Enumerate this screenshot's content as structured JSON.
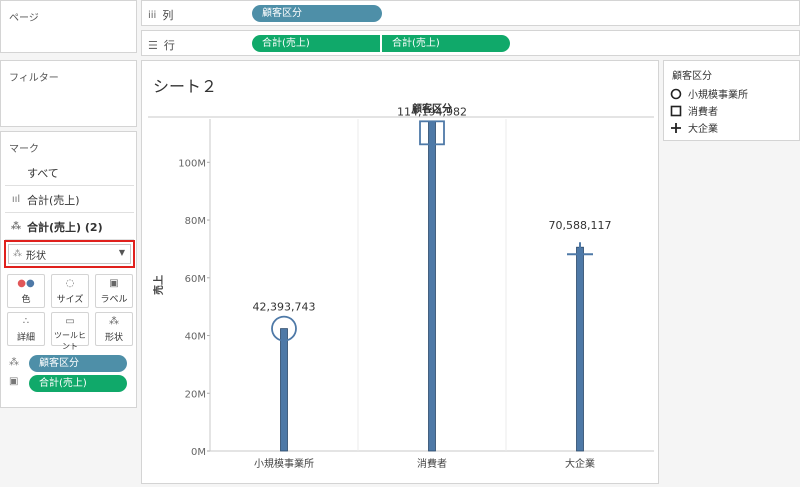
{
  "pages": {
    "title": "ページ"
  },
  "filters": {
    "title": "フィルター"
  },
  "columns": {
    "label": "列",
    "pills": [
      "顧客区分"
    ]
  },
  "rows": {
    "label": "行",
    "pills": [
      "合計(売上)",
      "合計(売上)"
    ]
  },
  "marks": {
    "title": "マーク",
    "items": [
      {
        "label": "すべて",
        "icon": "none"
      },
      {
        "label": "合計(売上)",
        "icon": "bar-chart-icon"
      },
      {
        "label": "合計(売上) (2)",
        "icon": "shape-icon",
        "active": true
      }
    ],
    "type_dropdown": "形状",
    "buttons": [
      {
        "label": "色",
        "icon": "color-dots-icon"
      },
      {
        "label": "サイズ",
        "icon": "size-icon"
      },
      {
        "label": "ラベル",
        "icon": "label-icon"
      },
      {
        "label": "詳細",
        "icon": "detail-dots-icon"
      },
      {
        "label": "ツールヒント",
        "icon": "tooltip-icon"
      },
      {
        "label": "形状",
        "icon": "shape-icon"
      }
    ],
    "fields": [
      {
        "label": "顧客区分",
        "icon": "shape-icon",
        "color": "#4e8fa8"
      },
      {
        "label": "合計(売上)",
        "icon": "label-icon",
        "color": "#10a96a"
      }
    ]
  },
  "sheet": {
    "title": "シート２"
  },
  "legend": {
    "title": "顧客区分",
    "items": [
      {
        "label": "小規模事業所",
        "shape": "circle"
      },
      {
        "label": "消費者",
        "shape": "square"
      },
      {
        "label": "大企業",
        "shape": "plus"
      }
    ]
  },
  "chart_data": {
    "type": "bar",
    "column_header": "顧客区分",
    "categories": [
      "小規模事業所",
      "消費者",
      "大企業"
    ],
    "values": [
      42393743,
      114194982,
      70588117
    ],
    "value_labels": [
      "42,393,743",
      "114,194,982",
      "70,588,117"
    ],
    "ylabel": "売上",
    "yticks": [
      "0M",
      "20M",
      "40M",
      "60M",
      "80M",
      "100M"
    ],
    "ylim": [
      0,
      115000000
    ],
    "bar_color": "#4e79a7",
    "shapes": [
      "circle",
      "square",
      "plus"
    ]
  }
}
